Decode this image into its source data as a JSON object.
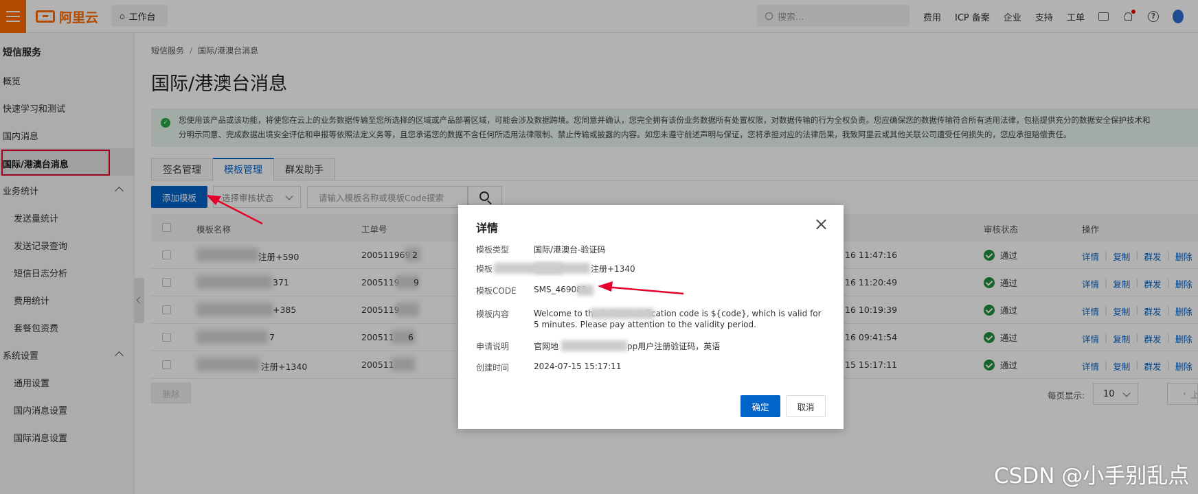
{
  "topbar": {
    "logo_text": "阿里云",
    "workbench": "工作台",
    "search_placeholder": "搜索...",
    "links": [
      "费用",
      "ICP 备案",
      "企业",
      "支持",
      "工单"
    ],
    "help_glyph": "?"
  },
  "sidebar": {
    "title": "短信服务",
    "items": {
      "overview": "概览",
      "quickstart": "快速学习和测试",
      "domestic": "国内消息",
      "international": "国际/港澳台消息",
      "stats_group": "业务统计",
      "send_stats": "发送量统计",
      "send_records": "发送记录查询",
      "sms_logs": "短信日志分析",
      "cost_stats": "费用统计",
      "packages": "套餐包资费",
      "settings_group": "系统设置",
      "general": "通用设置",
      "domestic_settings": "国内消息设置",
      "intl_settings": "国际消息设置"
    }
  },
  "main": {
    "breadcrumb": [
      "短信服务",
      "国际/港澳台消息"
    ],
    "breadcrumb_sep": "/",
    "title": "国际/港澳台消息",
    "notice_line1": "您使用该产品或该功能，将使您在云上的业务数据传输至您所选择的区域或产品部署区域，可能会涉及数据跨境。您同意并确认，您完全拥有该份业务数据所有处置权限，对数据传输的行为全权负责。您应确保您的数据传输符合所有适用法律，包括提供充分的数据安全保护技术和",
    "notice_line2": "分明示同意、完成数据出境安全评估和申报等依照法定义务等，且您承诺您的数据不含任何所适用法律限制、禁止传输或披露的内容。如您未遵守前述声明与保证，您将承担对应的法律后果，我致阿里云或其他关联公司遭受任何损失的，您应承担赔偿责任。",
    "tabs": [
      "签名管理",
      "模板管理",
      "群发助手"
    ],
    "add_button": "添加模板",
    "status_filter_placeholder": "选择审核状态",
    "search_placeholder": "请输入模板名称或模板Code搜索",
    "columns": {
      "name": "模板名称",
      "ticket": "工单号",
      "status": "审核状态",
      "actions": "操作"
    },
    "rows": [
      {
        "name": "注册+590",
        "ticket": "200511969",
        "ticket_end": "2",
        "time": "16 11:47:16",
        "status": "通过"
      },
      {
        "name": "371",
        "ticket": "2005119",
        "ticket_end": "9",
        "time": "16 11:20:49",
        "status": "通过"
      },
      {
        "name": "+385",
        "ticket": "2005119",
        "ticket_end": "",
        "time": "16 10:19:39",
        "status": "通过"
      },
      {
        "name": "7",
        "ticket": "200511",
        "ticket_end": "6",
        "time": "16 09:41:54",
        "status": "通过"
      },
      {
        "name": "注册+1340",
        "ticket": "200511",
        "ticket_end": "",
        "time": "15 15:17:11",
        "status": "通过"
      }
    ],
    "row_actions": [
      "详情",
      "复制",
      "群发",
      "删除"
    ],
    "delete_button": "删除",
    "page_size_label": "每页显示:",
    "page_size": "10",
    "prev_label": "上"
  },
  "modal": {
    "title": "详情",
    "fields": {
      "type_label": "模板类型",
      "type_value": "国际/港澳台-验证码",
      "name_label": "模板",
      "name_value": "注册+1340",
      "code_label": "模板CODE",
      "code_value": "SMS_469085",
      "content_label": "模板内容",
      "content_value": "Welcome to the                   \". Your verification code is ${code}, which is valid for 5 minutes. Please pay attention to the validity period.",
      "desc_label": "申请说明",
      "desc_prefix": "官网地",
      "desc_suffix": "pp用户注册验证码，英语",
      "created_label": "创建时间",
      "created_value": "2024-07-15 15:17:11"
    },
    "ok_button": "确定",
    "cancel_button": "取消"
  },
  "watermark": "CSDN @小手别乱点",
  "colors": {
    "brand_orange": "#ff6a00",
    "primary_blue": "#0064c8",
    "success_green": "#1e8e3e",
    "annotation_red": "#e4002b"
  }
}
